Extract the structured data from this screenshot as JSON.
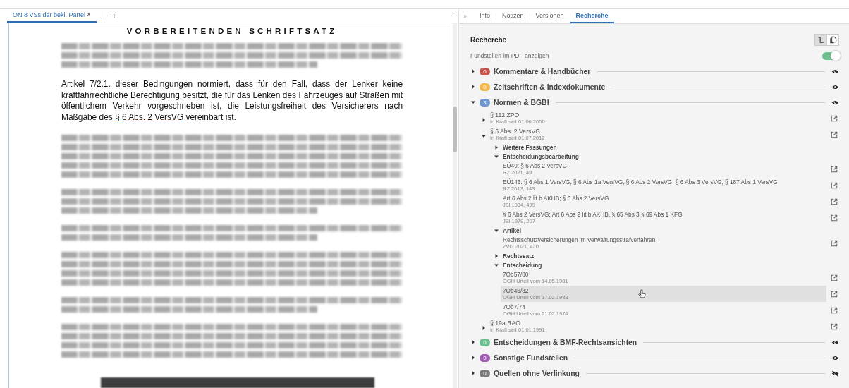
{
  "document_tabs": [
    {
      "label": "ON 8 VSs der bekl. Partei",
      "close": "×",
      "selected": true
    }
  ],
  "add_tab": "+",
  "more_menu": "···",
  "collapse_toggle": "»",
  "document": {
    "title": "VORBEREITENDEN SCHRIFTSATZ",
    "blocks": [
      {
        "kind": "blurred"
      },
      {
        "kind": "text",
        "before": "Artikel 7/2.1. dieser Bedingungen normiert, dass für den Fall, dass der Lenker keine kraftfahrrechtliche Berechtigung besitzt, die für das Lenken des Fahrzeuges auf Straßen mit öffentlichem Verkehr vorgeschrieben ist, die Leistungsfreiheit des Versicherers nach Maßgabe des ",
        "link": "§ 6 Abs. 2 VersVG",
        "after": " vereinbart ist."
      },
      {
        "kind": "blurred"
      },
      {
        "kind": "blurred"
      },
      {
        "kind": "blurred"
      },
      {
        "kind": "blurred"
      },
      {
        "kind": "blurred"
      },
      {
        "kind": "blurred"
      }
    ]
  },
  "panel_tabs": [
    {
      "label": "Info",
      "selected": false
    },
    {
      "label": "Notizen",
      "selected": false
    },
    {
      "label": "Versionen",
      "selected": false
    },
    {
      "label": "Recherche",
      "selected": true
    }
  ],
  "research": {
    "title": "Recherche",
    "view_buttons": [
      {
        "kind": "tree",
        "selected": true
      },
      {
        "kind": "copy",
        "selected": false
      }
    ],
    "pdf_toggle": {
      "label": "Fundstellen im PDF anzeigen",
      "on": true
    },
    "sections": [
      {
        "label": "Kommentare & Handbücher",
        "count": "0",
        "color": "#c9554f",
        "expanded": false,
        "visible": true
      },
      {
        "label": "Zeitschriften & Indexdokumente",
        "count": "0",
        "color": "#f2b84b",
        "expanded": false,
        "visible": true
      },
      {
        "label": "Normen & BGBl",
        "count": "3",
        "color": "#6e97d3",
        "expanded": true,
        "visible": true,
        "children": [
          {
            "title": "§ 112 ZPO",
            "subtitle": "In Kraft seit 01.06.2000",
            "expanded": false
          },
          {
            "title": "§ 6 Abs. 2 VersVG",
            "subtitle": "In Kraft seit 01.07.2012",
            "expanded": true,
            "groups": [
              {
                "label": "Weitere Fassungen",
                "expanded": false
              },
              {
                "label": "Entscheidungsbearbeitung",
                "expanded": true,
                "items": [
                  {
                    "title": "EÜ49: § 6 Abs 2 VersVG",
                    "subtitle": "RZ 2021, 49",
                    "highlighted": false
                  },
                  {
                    "title": "EÜ146: § 6 Abs 1 VersVG, § 6 Abs 1a VersVG, § 6 Abs 2 VersVG, § 6 Abs 3 VersVG, § 187 Abs 1 VersVG",
                    "subtitle": "RZ 2013, 143",
                    "highlighted": false
                  },
                  {
                    "title": "Art 6 Abs 2 lit b AKHB; § 6 Abs 2 VersVG",
                    "subtitle": "JBl 1984, 499",
                    "highlighted": false
                  },
                  {
                    "title": "§ 6 Abs 2 VersVG; Art 6 Abs 2 lit b AKHB, § 65 Abs 3 § 69 Abs 1 KFG",
                    "subtitle": "JBl 1979, 207",
                    "highlighted": false
                  }
                ]
              },
              {
                "label": "Artikel",
                "expanded": true,
                "items": [
                  {
                    "title": "Rechtsschutzversicherungen im Verwaltungsstrafverfahren",
                    "subtitle": "ZVG 2021, 420",
                    "highlighted": false
                  }
                ]
              },
              {
                "label": "Rechtssatz",
                "expanded": false
              },
              {
                "label": "Entscheidung",
                "expanded": true,
                "items": [
                  {
                    "title": "7Ob57/80",
                    "subtitle": "OGH Urteil vom 14.05.1981",
                    "highlighted": false
                  },
                  {
                    "title": "7Ob46/82",
                    "subtitle": "OGH Urteil vom 17.02.1983",
                    "highlighted": true
                  },
                  {
                    "title": "7Ob7/74",
                    "subtitle": "OGH Urteil vom 21.02.1974",
                    "highlighted": false
                  }
                ]
              }
            ]
          },
          {
            "title": "§ 19a RAO",
            "subtitle": "In Kraft seit 01.01.1991",
            "expanded": false
          }
        ]
      },
      {
        "label": "Entscheidungen & BMF-Rechtsansichten",
        "count": "0",
        "color": "#6cc18f",
        "expanded": false,
        "visible": true
      },
      {
        "label": "Sonstige Fundstellen",
        "count": "0",
        "color": "#a05cb4",
        "expanded": false,
        "visible": true
      },
      {
        "label": "Quellen ohne Verlinkung",
        "count": "0",
        "color": "#7b7b7b",
        "expanded": false,
        "visible": false
      }
    ]
  }
}
